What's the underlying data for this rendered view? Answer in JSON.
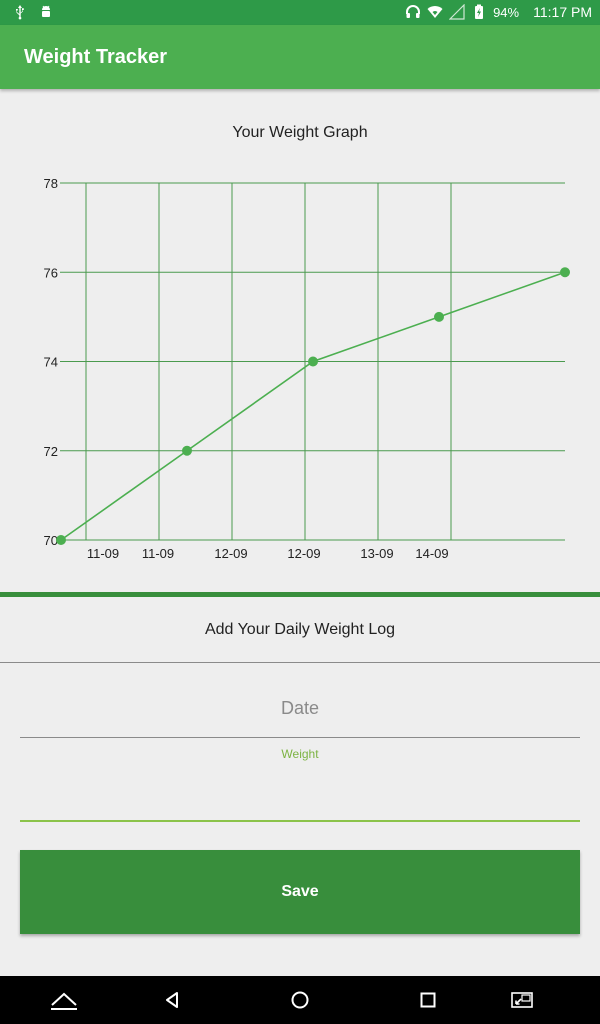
{
  "status_bar": {
    "battery": "94%",
    "time": "11:17 PM"
  },
  "app_bar": {
    "title": "Weight Tracker"
  },
  "graph": {
    "title": "Your Weight Graph"
  },
  "chart_data": {
    "type": "line",
    "title": "Your Weight Graph",
    "x_tick_labels": [
      "11-09",
      "11-09",
      "12-09",
      "12-09",
      "13-09",
      "14-09"
    ],
    "y_ticks": [
      70,
      72,
      74,
      76,
      78
    ],
    "ylim": [
      70,
      78
    ],
    "grid": true,
    "series": [
      {
        "color": "#4caf50",
        "points": [
          70,
          72,
          74,
          75,
          76
        ]
      }
    ]
  },
  "log_section": {
    "title": "Add Your Daily Weight Log",
    "date_placeholder": "Date",
    "date_value": "",
    "weight_label": "Weight",
    "weight_value": "",
    "save_label": "Save"
  },
  "colors": {
    "status_bar": "#2e9a48",
    "app_bar": "#4caf50",
    "primary_dark": "#388e3c",
    "accent": "#8bc34a"
  },
  "nav_icons": [
    "keyboard-hide-icon",
    "back-icon",
    "home-icon",
    "recents-icon",
    "screen-rotate-icon"
  ]
}
